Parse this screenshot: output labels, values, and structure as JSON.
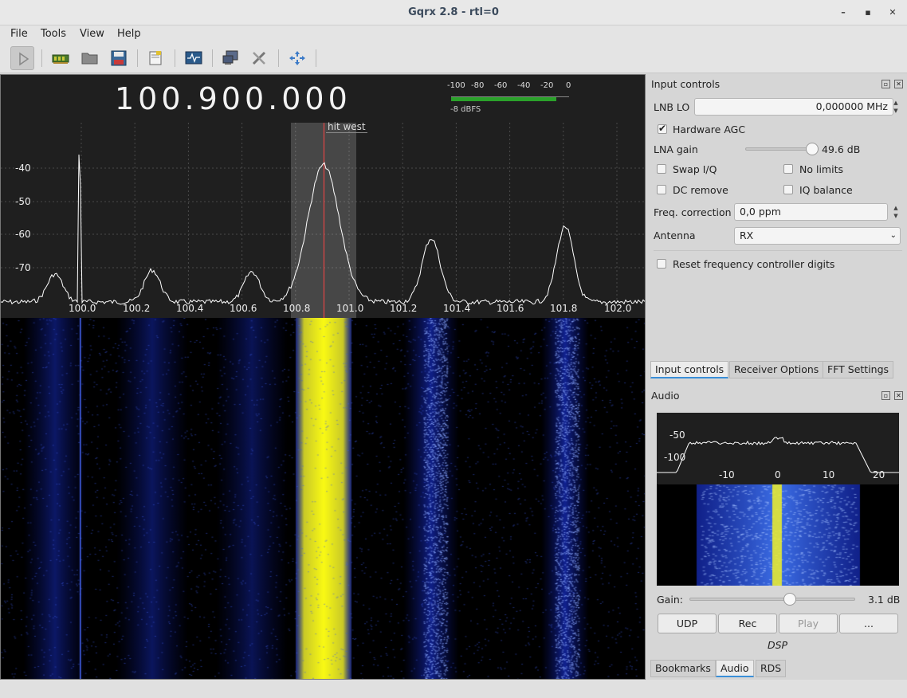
{
  "window": {
    "title": "Gqrx 2.8 - rtl=0"
  },
  "menu": [
    "File",
    "Tools",
    "View",
    "Help"
  ],
  "toolbar": {
    "icons": [
      "play-icon",
      "hardware-icon",
      "open-icon",
      "save-icon",
      "note-icon",
      "monitor-icon",
      "remote-icon",
      "settings-icon",
      "fullscreen-icon"
    ]
  },
  "display": {
    "frequency": "100.900.000",
    "meter": {
      "ticks": [
        "-100",
        "-80",
        "-60",
        "-40",
        "-20",
        "0"
      ],
      "reading": "-8 dBFS",
      "level_fraction": 0.89
    },
    "y_axis": [
      "-40",
      "-50",
      "-60",
      "-70"
    ],
    "x_axis": [
      "100.0",
      "100.2",
      "100.4",
      "100.6",
      "100.8",
      "101.0",
      "101.2",
      "101.4",
      "101.6",
      "101.8",
      "102.0"
    ],
    "bookmark_label": "hit west",
    "accent": "#ff4444"
  },
  "input_controls": {
    "title": "Input controls",
    "lnb_lo_label": "LNB LO",
    "lnb_lo_value": "0,000000 MHz",
    "hardware_agc": "Hardware AGC",
    "lna_gain_label": "LNA gain",
    "lna_gain_value": "49.6 dB",
    "lna_gain_fraction": 0.99,
    "swap_iq": "Swap I/Q",
    "no_limits": "No limits",
    "dc_remove": "DC remove",
    "iq_balance": "IQ balance",
    "freq_corr_label": "Freq. correction",
    "freq_corr_value": "0,0 ppm",
    "antenna_label": "Antenna",
    "antenna_value": "RX",
    "reset_digits": "Reset frequency controller digits"
  },
  "tabs_top": [
    "Input controls",
    "Receiver Options",
    "FFT Settings"
  ],
  "audio": {
    "title": "Audio",
    "y_axis": [
      "-50",
      "-100"
    ],
    "x_axis": [
      "-10",
      "0",
      "10",
      "20"
    ],
    "gain_label": "Gain:",
    "gain_value": "3.1 dB",
    "gain_fraction": 0.6,
    "buttons": [
      "UDP",
      "Rec",
      "Play",
      "..."
    ],
    "dsp_label": "DSP"
  },
  "tabs_bottom": [
    "Bookmarks",
    "Audio",
    "RDS"
  ]
}
